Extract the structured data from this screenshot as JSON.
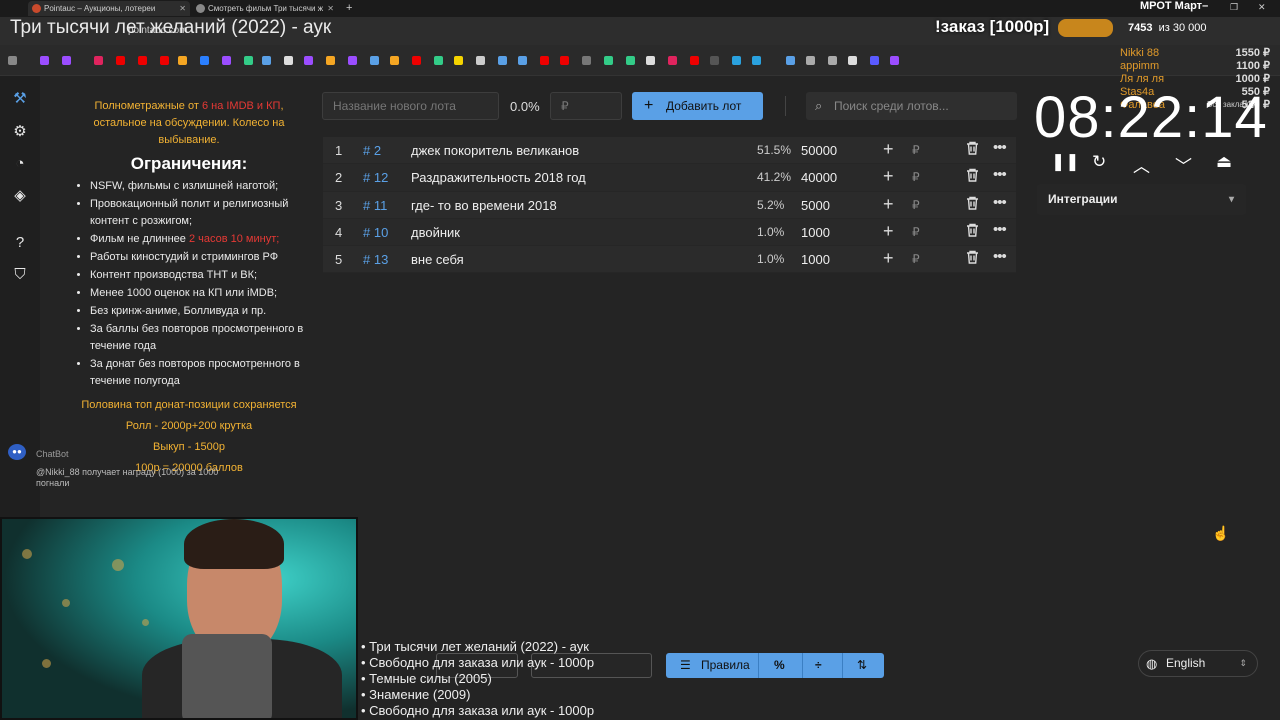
{
  "browser": {
    "tabs": [
      {
        "label": "Pointauc – Аукционы, лотереи"
      },
      {
        "label": "Смотреть фильм Три тысячи ж"
      }
    ],
    "url": "pointauc.com",
    "all_bookmarks": "Все закладки"
  },
  "stream_overlay": {
    "title": "Три тысячи лет желаний (2022) - аук",
    "order_label": "!заказ [1000р]",
    "mrot_label": "МРОТ Март–",
    "goal_current": "7453",
    "goal_target": "из 30 000",
    "donors": [
      {
        "name": "Nikki 88",
        "amount": "1550 ₽"
      },
      {
        "name": "appimm",
        "amount": "1100 ₽"
      },
      {
        "name": "Ля ля ля",
        "amount": "1000 ₽"
      },
      {
        "name": "Stas4a",
        "amount": "550 ₽"
      },
      {
        "name": "Фалавеа",
        "amount": "520 ₽"
      }
    ],
    "now_playing": [
      "• Три тысячи лет желаний (2022) - аук",
      "• Свободно для заказа или аук - 1000р",
      "• Темные силы (2005)",
      "• Знамение (2009)",
      "• Свободно для заказа или аук - 1000р"
    ]
  },
  "rules": {
    "intro_a": "Полнометражные от ",
    "intro_red": "6 на IMDB и КП",
    "intro_b": ", остальное на обсуждении. Колесо на выбывание.",
    "heading": "Ограничения:",
    "items": [
      "NSFW, фильмы с излишней наготой;",
      "Провокационный полит и религиозный контент с розжигом;",
      "Фильм не длиннее ",
      "Работы киностудий и стримингов РФ",
      "Контент производства ТНТ и ВК;",
      "Менее 1000 оценок на КП или iMDB;",
      "Без кринж-аниме, Болливуда и пр.",
      "За баллы без повторов просмотренного в течение года",
      "За донат без повторов просмотренного в течение полугода"
    ],
    "length_red": "2 часов 10 минут;",
    "footer": [
      "Половина топ донат-позиции сохраняется",
      "Ролл - 2000р+200 крутка",
      "Выкуп - 1500р",
      "100р = 20000 баллов"
    ]
  },
  "chatbot": {
    "name": "ChatBot",
    "message": "@Nikki_88 получает награду (1000) за 1000 погнали"
  },
  "toolbar": {
    "new_lot_placeholder": "Название нового лота",
    "percent": "0.0%",
    "amount_placeholder": "₽",
    "add_label": "Добавить лот",
    "search_placeholder": "Поиск среди лотов..."
  },
  "lots": [
    {
      "idx": "1",
      "id": "# 2",
      "name": "джек покоритель великанов",
      "pct": "51.5%",
      "amount": "50000"
    },
    {
      "idx": "2",
      "id": "# 12",
      "name": "Раздражительность 2018 год",
      "pct": "41.2%",
      "amount": "40000"
    },
    {
      "idx": "3",
      "id": "# 11",
      "name": "где- то во времени 2018",
      "pct": "5.2%",
      "amount": "5000"
    },
    {
      "idx": "4",
      "id": "# 10",
      "name": "двойник",
      "pct": "1.0%",
      "amount": "1000"
    },
    {
      "idx": "5",
      "id": "# 13",
      "name": "вне себя",
      "pct": "1.0%",
      "amount": "1000"
    }
  ],
  "currency_symbol": "₽",
  "timer": {
    "value": "08:22:14"
  },
  "integrations": {
    "label": "Интеграции"
  },
  "bottom": {
    "rules_label": "Правила"
  },
  "language": {
    "selected": "English"
  },
  "colors": {
    "accent": "#5aa0e6",
    "gold": "#f2b233",
    "warning": "#e53935"
  }
}
